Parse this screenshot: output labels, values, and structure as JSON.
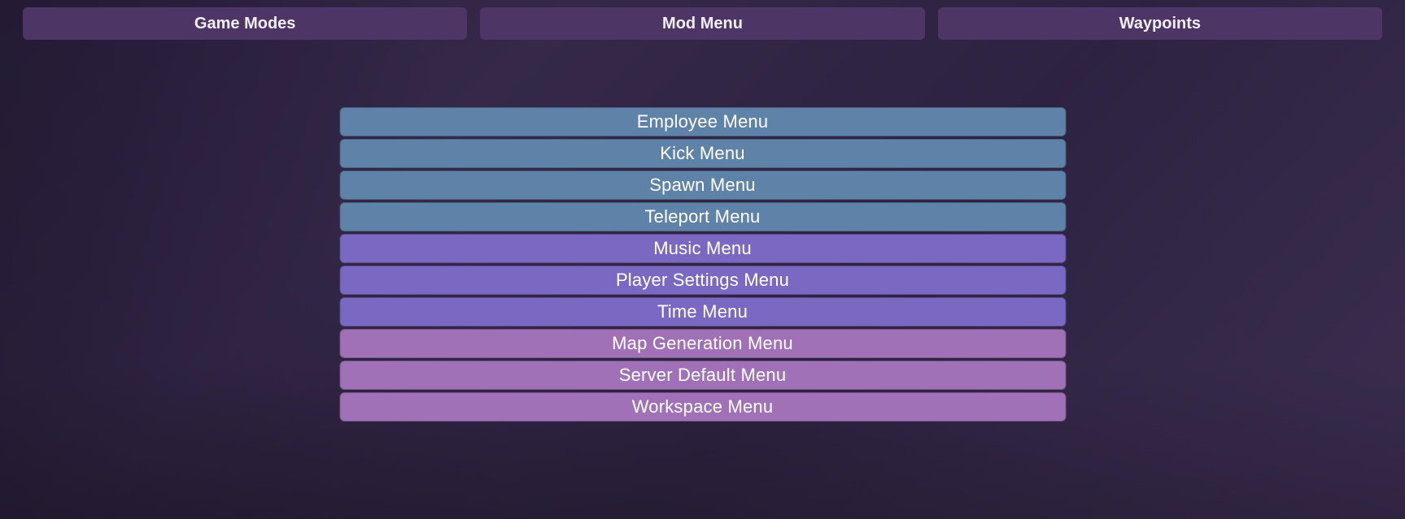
{
  "tabs": {
    "game_modes": "Game Modes",
    "mod_menu": "Mod Menu",
    "waypoints": "Waypoints"
  },
  "menu": {
    "items": [
      {
        "label": "Employee Menu",
        "group": "blue"
      },
      {
        "label": "Kick Menu",
        "group": "blue"
      },
      {
        "label": "Spawn Menu",
        "group": "blue"
      },
      {
        "label": "Teleport Menu",
        "group": "blue"
      },
      {
        "label": "Music Menu",
        "group": "violet"
      },
      {
        "label": "Player Settings Menu",
        "group": "violet"
      },
      {
        "label": "Time Menu",
        "group": "violet"
      },
      {
        "label": "Map Generation Menu",
        "group": "mauve"
      },
      {
        "label": "Server Default Menu",
        "group": "mauve"
      },
      {
        "label": "Workspace Menu",
        "group": "mauve"
      }
    ]
  },
  "colors": {
    "tab_bg": "#4d3566",
    "blue": "#5f82a8",
    "violet": "#7b68c2",
    "mauve": "#a071b7"
  }
}
